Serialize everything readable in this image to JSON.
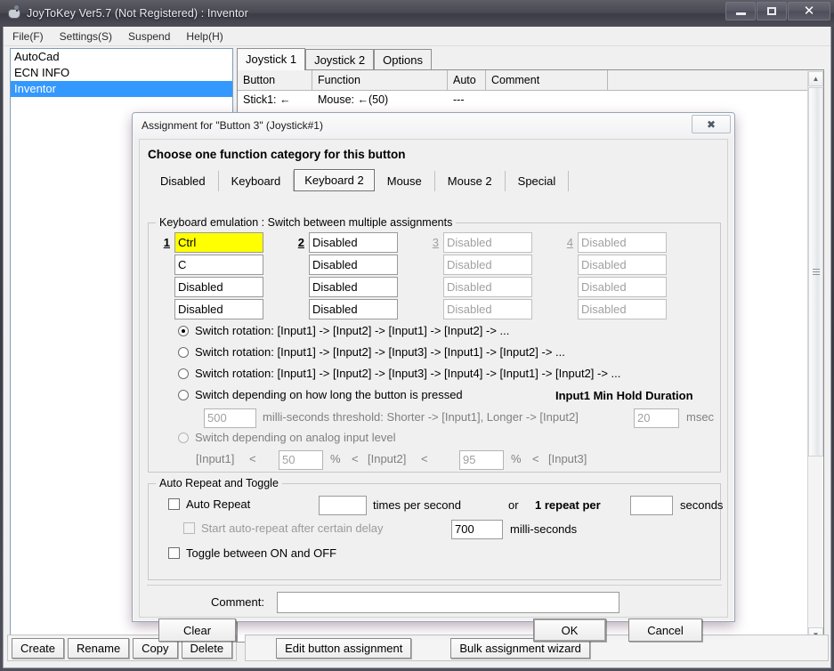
{
  "window": {
    "title": "JoyToKey Ver5.7 (Not Registered) : Inventor",
    "icon": "joystick-icon",
    "minimize_label": "–",
    "maximize_label": "□",
    "close_label": "✕"
  },
  "menu": {
    "items": [
      {
        "label": "File(F)"
      },
      {
        "label": "Settings(S)"
      },
      {
        "label": "Suspend"
      },
      {
        "label": "Help(H)"
      }
    ]
  },
  "profiles": {
    "items": [
      {
        "label": "AutoCad",
        "selected": false
      },
      {
        "label": "ECN INFO",
        "selected": false
      },
      {
        "label": "Inventor",
        "selected": true
      }
    ]
  },
  "joystick_tabs": [
    {
      "label": "Joystick 1",
      "active": true
    },
    {
      "label": "Joystick 2",
      "active": false
    },
    {
      "label": "Options",
      "active": false
    }
  ],
  "assignment_grid": {
    "columns": [
      "Button",
      "Function",
      "Auto",
      "Comment",
      ""
    ],
    "rows": [
      {
        "button": "Stick1: ←",
        "function": "Mouse: ←(50)",
        "auto": "---",
        "comment": "",
        "extra": ""
      }
    ]
  },
  "bottom_toolbar": {
    "profile_buttons": [
      "Create",
      "Rename",
      "Copy",
      "Delete"
    ],
    "action_buttons": [
      "Edit button assignment",
      "Bulk assignment wizard"
    ]
  },
  "dialog": {
    "title": "Assignment for \"Button 3\" (Joystick#1)",
    "close_label": "✖",
    "heading": "Choose one function category for this button",
    "category_tabs": [
      {
        "label": "Disabled",
        "active": false
      },
      {
        "label": "Keyboard",
        "active": false
      },
      {
        "label": "Keyboard 2",
        "active": true
      },
      {
        "label": "Mouse",
        "active": false
      },
      {
        "label": "Mouse 2",
        "active": false
      },
      {
        "label": "Special",
        "active": false
      }
    ],
    "keyboard_group": {
      "legend": "Keyboard emulation : Switch between multiple assignments",
      "columns": [
        {
          "number": "1",
          "disabled": false,
          "slots": [
            {
              "value": "Ctrl",
              "highlight": true
            },
            {
              "value": "C",
              "highlight": false
            },
            {
              "value": "Disabled",
              "highlight": false
            },
            {
              "value": "Disabled",
              "highlight": false
            }
          ]
        },
        {
          "number": "2",
          "disabled": false,
          "slots": [
            {
              "value": "Disabled",
              "highlight": false
            },
            {
              "value": "Disabled",
              "highlight": false
            },
            {
              "value": "Disabled",
              "highlight": false
            },
            {
              "value": "Disabled",
              "highlight": false
            }
          ]
        },
        {
          "number": "3",
          "disabled": true,
          "slots": [
            {
              "value": "Disabled",
              "highlight": false
            },
            {
              "value": "Disabled",
              "highlight": false
            },
            {
              "value": "Disabled",
              "highlight": false
            },
            {
              "value": "Disabled",
              "highlight": false
            }
          ]
        },
        {
          "number": "4",
          "disabled": true,
          "slots": [
            {
              "value": "Disabled",
              "highlight": false
            },
            {
              "value": "Disabled",
              "highlight": false
            },
            {
              "value": "Disabled",
              "highlight": false
            },
            {
              "value": "Disabled",
              "highlight": false
            }
          ]
        }
      ],
      "switch_modes": [
        {
          "label": "Switch rotation: [Input1] -> [Input2] -> [Input1] -> [Input2] -> ...",
          "selected": true,
          "disabled": false
        },
        {
          "label": "Switch rotation: [Input1] -> [Input2] -> [Input3] -> [Input1] -> [Input2] -> ...",
          "selected": false,
          "disabled": false
        },
        {
          "label": "Switch rotation: [Input1] -> [Input2] -> [Input3] -> [Input4] -> [Input1] -> [Input2] -> ...",
          "selected": false,
          "disabled": false
        },
        {
          "label": "Switch depending on how long the button is pressed",
          "selected": false,
          "disabled": false
        },
        {
          "label": "Switch depending on analog input level",
          "selected": false,
          "disabled": false
        }
      ],
      "hold_duration_label": "Input1 Min Hold Duration",
      "threshold_value": "500",
      "threshold_label": "milli-seconds threshold: Shorter -> [Input1], Longer -> [Input2]",
      "min_hold_value": "20",
      "min_hold_unit": "msec",
      "analog": {
        "input1_label": "[Input1]",
        "lt1": "<",
        "value1": "50",
        "pct1": "%",
        "lt2": "<",
        "input2_label": "[Input2]",
        "lt3": "<",
        "value2": "95",
        "pct2": "%",
        "lt4": "<",
        "input3_label": "[Input3]"
      }
    },
    "auto_repeat_group": {
      "legend": "Auto Repeat and Toggle",
      "auto_repeat_label": "Auto Repeat",
      "auto_repeat_checked": false,
      "rate_value": "",
      "rate_unit": "times per second",
      "or_label": "or",
      "one_repeat_label": "1 repeat per",
      "period_value": "",
      "period_unit": "seconds",
      "delay_label": "Start auto-repeat after certain delay",
      "delay_checked": false,
      "delay_disabled": true,
      "delay_value": "700",
      "delay_unit": "milli-seconds",
      "toggle_label": "Toggle between ON and OFF",
      "toggle_checked": false
    },
    "comment": {
      "label": "Comment:",
      "value": ""
    },
    "buttons": {
      "clear": "Clear",
      "ok": "OK",
      "cancel": "Cancel"
    }
  },
  "colors": {
    "highlight_yellow": "#ffff00",
    "selection_blue": "#3399ff",
    "dialog_bg": "#f0f0f0"
  }
}
